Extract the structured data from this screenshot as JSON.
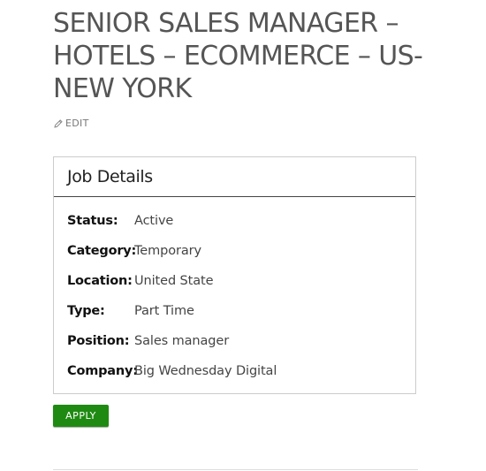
{
  "job": {
    "title": "SENIOR SALES MANAGER – HOTELS – ECOMMERCE – US-NEW YORK",
    "edit_label": "EDIT",
    "edit_icon": "pencil-icon"
  },
  "details": {
    "heading": "Job Details",
    "rows": [
      {
        "label": "Status:",
        "value": "Active"
      },
      {
        "label": "Category:",
        "value": "Temporary"
      },
      {
        "label": "Location:",
        "value": "United State"
      },
      {
        "label": "Type:",
        "value": "Part Time"
      },
      {
        "label": "Position:",
        "value": "Sales manager"
      },
      {
        "label": "Company:",
        "value": "Big Wednesday Digital"
      }
    ]
  },
  "actions": {
    "apply_label": "APPLY",
    "apply_color": "#1f8a12"
  }
}
